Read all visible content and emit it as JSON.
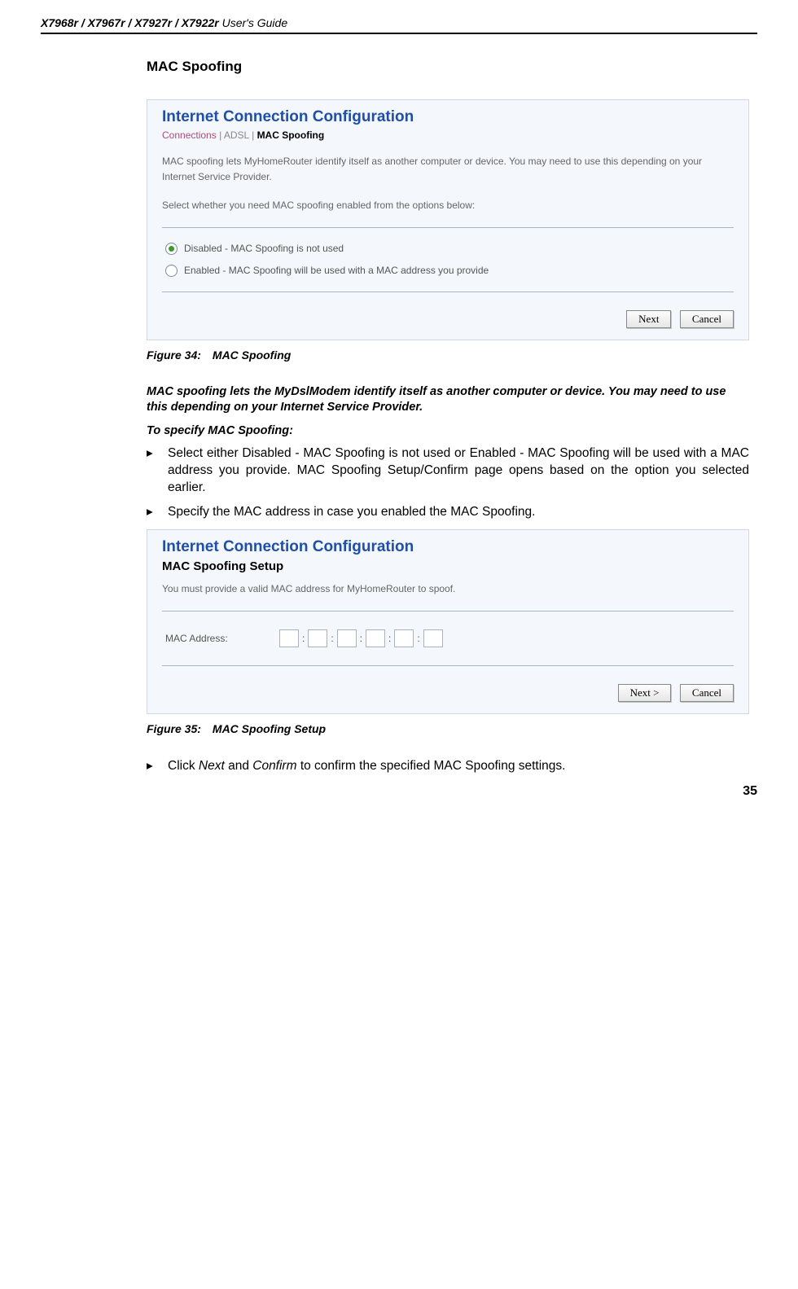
{
  "header": {
    "models": "X7968r / X7967r / X7927r / X7922r",
    "title_suffix": " User's Guide"
  },
  "section_title": "MAC Spoofing",
  "panel1": {
    "title": "Internet Connection Configuration",
    "breadcrumb": {
      "connections": "Connections",
      "sep": " | ",
      "adsl": "ADSL",
      "current": "MAC Spoofing"
    },
    "desc1": "MAC spoofing lets MyHomeRouter identify itself as another computer or device. You may need to use this depending on your Internet Service Provider.",
    "desc2": "Select whether you need MAC spoofing enabled from the options below:",
    "opt_disabled": "Disabled - MAC Spoofing is not used",
    "opt_enabled": "Enabled - MAC Spoofing will be used with a MAC address you provide",
    "btn_next": "Next",
    "btn_cancel": "Cancel"
  },
  "fig34": "Figure 34: MAC Spoofing",
  "para_intro": "MAC spoofing lets the MyDslModem identify itself as another computer or device. You may need to use this depending on your Internet Service Provider.",
  "para_to_specify": "To specify MAC Spoofing:",
  "bullet1": "Select either Disabled - MAC Spoofing is not used or Enabled - MAC Spoofing will be used with a MAC address you provide. MAC Spoofing Setup/Confirm page opens based on the option you selected earlier.",
  "bullet2": "Specify the MAC address in case you enabled the MAC Spoofing.",
  "panel2": {
    "title": "Internet Connection Configuration",
    "subtitle": "MAC Spoofing Setup",
    "desc": "You must provide a valid MAC address for MyHomeRouter to spoof.",
    "mac_label": "MAC Address:",
    "btn_next": "Next >",
    "btn_cancel": "Cancel"
  },
  "fig35": "Figure 35: MAC Spoofing Setup",
  "bullet3_pre": "Click ",
  "bullet3_next": "Next",
  "bullet3_mid": " and ",
  "bullet3_confirm": "Confirm",
  "bullet3_post": " to confirm the specified MAC Spoofing settings.",
  "page_number": "35"
}
